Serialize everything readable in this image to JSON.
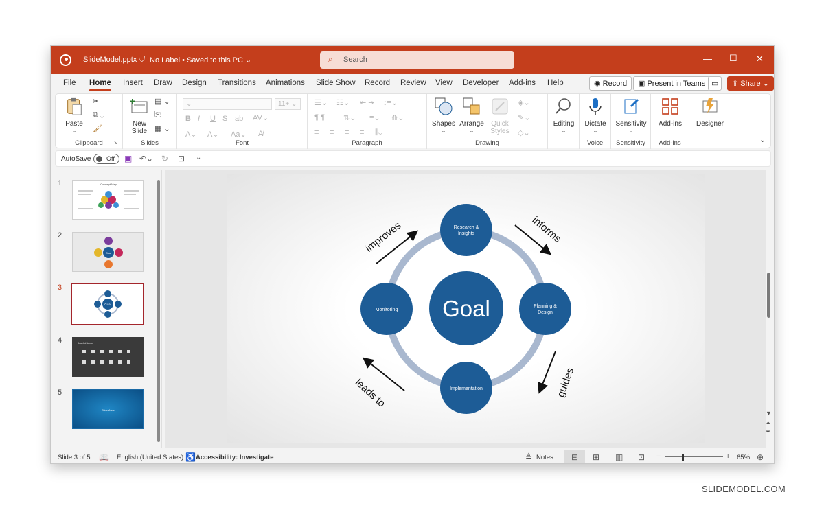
{
  "window": {
    "file_name": "SlideModel.pptx",
    "label_status": "No Label",
    "save_status": "Saved to this PC"
  },
  "search": {
    "placeholder": "Search"
  },
  "tabs": [
    "File",
    "Home",
    "Insert",
    "Draw",
    "Design",
    "Transitions",
    "Animations",
    "Slide Show",
    "Record",
    "Review",
    "View",
    "Developer",
    "Add-ins",
    "Help"
  ],
  "active_tab": "Home",
  "title_actions": {
    "record": "Record",
    "present": "Present in Teams",
    "share": "Share"
  },
  "ribbon": {
    "clipboard": {
      "label": "Clipboard",
      "paste": "Paste"
    },
    "slides": {
      "label": "Slides",
      "new_slide_1": "New",
      "new_slide_2": "Slide"
    },
    "font": {
      "label": "Font",
      "size": "11+"
    },
    "paragraph": {
      "label": "Paragraph"
    },
    "drawing": {
      "label": "Drawing",
      "shapes": "Shapes",
      "arrange": "Arrange",
      "quick_1": "Quick",
      "quick_2": "Styles"
    },
    "editing": {
      "label": "Editing"
    },
    "voice": {
      "label": "Voice",
      "dictate": "Dictate"
    },
    "sensitivity": {
      "label": "Sensitivity",
      "button": "Sensitivity"
    },
    "addins": {
      "label": "Add-ins",
      "button": "Add-ins"
    },
    "designer": {
      "button": "Designer"
    }
  },
  "qat": {
    "autosave": "AutoSave",
    "toggle": "Off"
  },
  "thumbnails": [
    {
      "num": "1",
      "title": "Concept Map"
    },
    {
      "num": "2",
      "center": "Goal"
    },
    {
      "num": "3",
      "center": "Goal"
    },
    {
      "num": "4",
      "title": "Useful Icons"
    },
    {
      "num": "5",
      "brand": "SlideModel"
    }
  ],
  "slide": {
    "center": "Goal",
    "nodes": {
      "top": "Research & Insights",
      "right": "Planning & Design",
      "bottom": "Implementation",
      "left": "Monitoring"
    },
    "arrows": {
      "tl": "improves",
      "tr": "informs",
      "br": "guides",
      "bl": "leads to"
    },
    "colors": {
      "node": "#1d5c96",
      "ring": "#a9b8cf",
      "accent": "#c43e1c"
    }
  },
  "status": {
    "slide_pos": "Slide 3 of 5",
    "language": "English (United States)",
    "accessibility": "Accessibility: Investigate",
    "notes": "Notes",
    "zoom": "65%"
  },
  "watermark": "SLIDEMODEL.COM"
}
